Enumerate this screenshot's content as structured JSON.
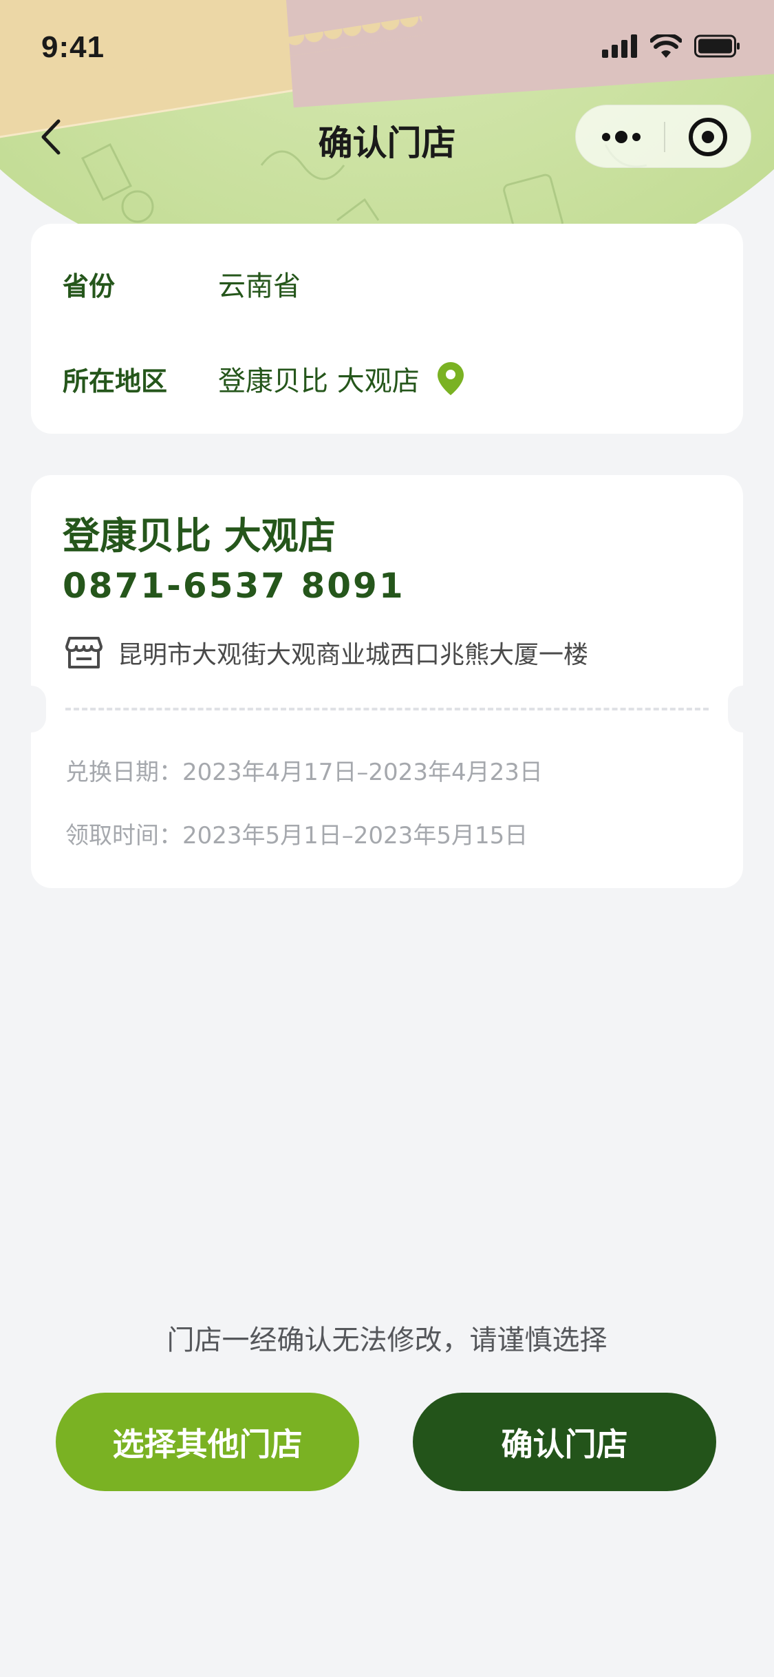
{
  "status_bar": {
    "time": "9:41",
    "icons": [
      "cellular-signal-icon",
      "wifi-icon",
      "battery-icon"
    ]
  },
  "nav": {
    "title": "确认门店",
    "back_icon": "chevron-left-icon",
    "capsule_icons": [
      "more-dots-icon",
      "target-circle-icon"
    ]
  },
  "region": {
    "province_label": "省份",
    "province_value": "云南省",
    "area_label": "所在地区",
    "area_value": "登康贝比 大观店",
    "area_icon": "location-pin-icon"
  },
  "store": {
    "name": "登康贝比 大观店",
    "phone": "0871-6537 8091",
    "address_icon": "storefront-icon",
    "address": "昆明市大观街大观商业城西口兆熊大厦一楼",
    "exchange_date": "兑换日期：2023年4月17日–2023年4月23日",
    "pickup_time": "领取时间：2023年5月1日–2023年5月15日"
  },
  "footer": {
    "notice": "门店一经确认无法修改，请谨慎选择",
    "other_button": "选择其他门店",
    "confirm_button": "确认门店"
  },
  "colors": {
    "primary_dark": "#23541a",
    "primary_light": "#7ab223",
    "text_green": "#25561b",
    "background": "#f3f4f6"
  }
}
